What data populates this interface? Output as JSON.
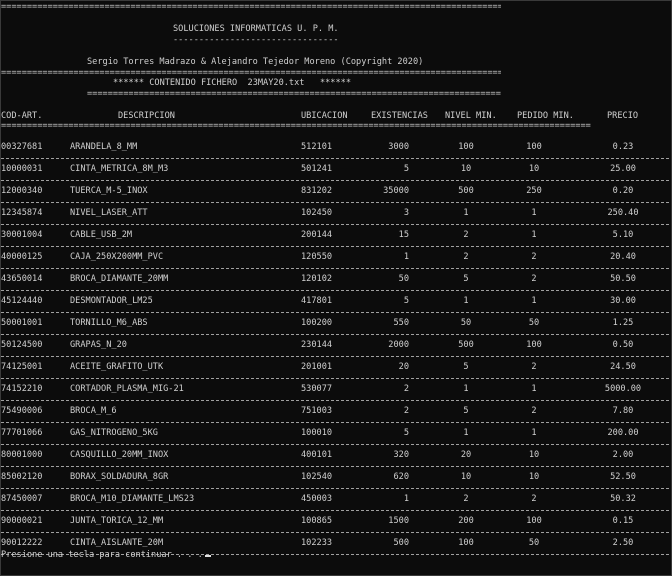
{
  "header": {
    "rule_top": "================================================================================================================",
    "org_title": "SOLUCIONES INFORMATICAS U. P. M.",
    "org_underline": "--------------------------------",
    "authors": "Sergio Torres Madrazo & Alejandro Tejedor Moreno (Copyright 2020)",
    "rule_mid": "================================================================================================================",
    "file_title": "****** CONTENIDO FICHERO  23MAY20.txt   ******",
    "file_underline": "================================================================================"
  },
  "table": {
    "columns": [
      "COD-ART.",
      "DESCRIPCION",
      "UBICACION",
      "EXISTENCIAS",
      "NIVEL MIN.",
      "PEDIDO MIN.",
      "PRECIO"
    ],
    "header_rule": "==================================================================================================================",
    "rows": [
      [
        "00327681",
        "ARANDELA_8_MM",
        "512101",
        "3000",
        "100",
        "100",
        "0.23"
      ],
      [
        "10000031",
        "CINTA_METRICA_8M_M3",
        "501241",
        "5",
        "10",
        "10",
        "25.00"
      ],
      [
        "12000340",
        "TUERCA_M-5_INOX",
        "831202",
        "35000",
        "500",
        "250",
        "0.20"
      ],
      [
        "12345874",
        "NIVEL_LASER_ATT",
        "102450",
        "3",
        "1",
        "1",
        "250.40"
      ],
      [
        "30001004",
        "CABLE_USB_2M",
        "200144",
        "15",
        "2",
        "1",
        "5.10"
      ],
      [
        "40000125",
        "CAJA_250X200MM_PVC",
        "120550",
        "1",
        "2",
        "2",
        "20.40"
      ],
      [
        "43650014",
        "BROCA_DIAMANTE_20MM",
        "120102",
        "50",
        "5",
        "2",
        "50.50"
      ],
      [
        "45124440",
        "DESMONTADOR_LM25",
        "417801",
        "5",
        "1",
        "1",
        "30.00"
      ],
      [
        "50001001",
        "TORNILLO_M6_ABS",
        "100200",
        "550",
        "50",
        "50",
        "1.25"
      ],
      [
        "50124500",
        "GRAPAS_N_20",
        "230144",
        "2000",
        "500",
        "100",
        "0.50"
      ],
      [
        "74125001",
        "ACEITE_GRAFITO_UTK",
        "201001",
        "20",
        "5",
        "2",
        "24.50"
      ],
      [
        "74152210",
        "CORTADOR_PLASMA_MIG-21",
        "530077",
        "2",
        "1",
        "1",
        "5000.00"
      ],
      [
        "75490006",
        "BROCA_M_6",
        "751003",
        "2",
        "5",
        "2",
        "7.80"
      ],
      [
        "77701066",
        "GAS_NITROGENO_5KG",
        "100010",
        "5",
        "1",
        "1",
        "200.00"
      ],
      [
        "80001000",
        "CASQUILLO_20MM_INOX",
        "400101",
        "320",
        "20",
        "10",
        "2.00"
      ],
      [
        "85002120",
        "BORAX_SOLDADURA_8GR",
        "102540",
        "620",
        "10",
        "10",
        "52.50"
      ],
      [
        "87450007",
        "BROCA_M10_DIAMANTE_LMS23",
        "450003",
        "1",
        "2",
        "2",
        "50.32"
      ],
      [
        "90000021",
        "JUNTA_TORICA_12_MM",
        "100865",
        "1500",
        "200",
        "100",
        "0.15"
      ],
      [
        "90012222",
        "CINTA_AISLANTE_20M",
        "102233",
        "500",
        "100",
        "50",
        "2.50"
      ]
    ]
  },
  "footer": {
    "prompt": "Presione una tecla para continuar . . ."
  }
}
